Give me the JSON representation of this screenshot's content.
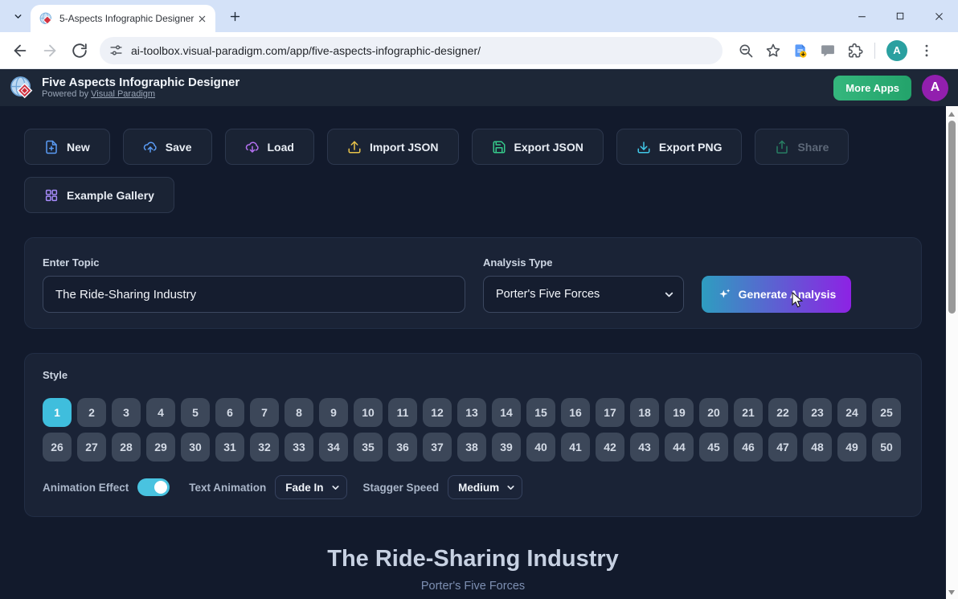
{
  "browser": {
    "tab_title": "5-Aspects Infographic Designer",
    "url": "ai-toolbox.visual-paradigm.com/app/five-aspects-infographic-designer/",
    "profile_initial": "A",
    "nav_icons": [
      "tab-search-icon",
      "favicon",
      "close-icon",
      "new-tab-icon",
      "minimize-icon",
      "maximize-icon",
      "close-window-icon",
      "back-icon",
      "forward-icon",
      "reload-icon",
      "tune-icon",
      "zoom-icon",
      "bookmark-star-icon",
      "docs-offline-icon",
      "feedback-icon",
      "extensions-icon",
      "profile-avatar",
      "menu-dots-icon"
    ]
  },
  "header": {
    "title": "Five Aspects Infographic Designer",
    "powered_prefix": "Powered by",
    "powered_link": "Visual Paradigm",
    "more_apps_label": "More Apps",
    "avatar_initial": "A",
    "accent_green": "#2fb075"
  },
  "toolbar": {
    "buttons": [
      {
        "label": "New",
        "icon": "file-plus-icon",
        "color": "#5b9cf5",
        "disabled": false
      },
      {
        "label": "Save",
        "icon": "cloud-upload-icon",
        "color": "#5b9cf5",
        "disabled": false
      },
      {
        "label": "Load",
        "icon": "cloud-download-icon",
        "color": "#b571f2",
        "disabled": false
      },
      {
        "label": "Import JSON",
        "icon": "upload-icon",
        "color": "#e9c44a",
        "disabled": false
      },
      {
        "label": "Export JSON",
        "icon": "floppy-icon",
        "color": "#35c98a",
        "disabled": false
      },
      {
        "label": "Export PNG",
        "icon": "download-icon",
        "color": "#41c8e8",
        "disabled": false
      },
      {
        "label": "Share",
        "icon": "share-icon",
        "color": "#35c98a",
        "disabled": true
      }
    ],
    "gallery_label": "Example Gallery",
    "gallery_icon": "grid-icon"
  },
  "form": {
    "topic_label": "Enter Topic",
    "topic_value": "The Ride-Sharing Industry",
    "analysis_label": "Analysis Type",
    "analysis_value": "Porter's Five Forces",
    "generate_label": "Generate Analysis",
    "generate_icon": "sparkle-icon",
    "generate_gradient": [
      "#2e9dc0",
      "#8d22e4"
    ]
  },
  "style_section": {
    "label": "Style",
    "from": 1,
    "to": 50,
    "selected": 1,
    "selected_color": "#3fbedd",
    "animation_label": "Animation Effect",
    "animation_on": true,
    "text_animation_label": "Text Animation",
    "text_animation_value": "Fade In",
    "stagger_label": "Stagger Speed",
    "stagger_value": "Medium"
  },
  "preview": {
    "title": "The Ride-Sharing Industry",
    "subtitle": "Porter's Five Forces"
  }
}
